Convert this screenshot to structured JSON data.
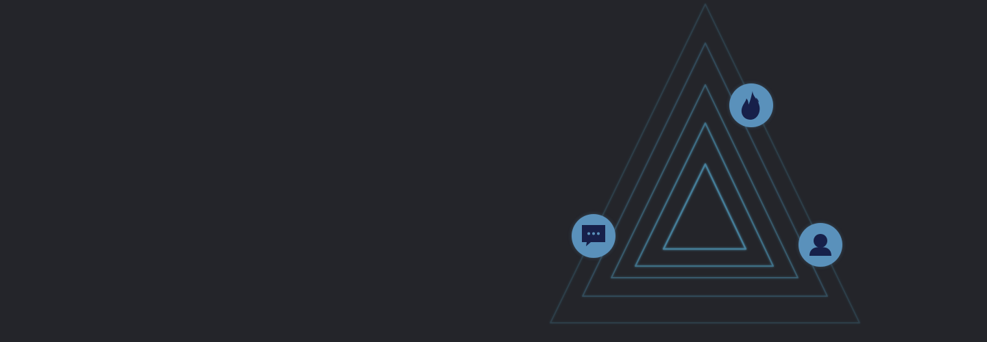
{
  "colors": {
    "background": "#24252a",
    "triangle_stroke": "#4a8aa8",
    "badge_fill": "#5a91bb",
    "icon_fill": "#17204a"
  },
  "icons": {
    "top": "flame-icon",
    "left": "chat-bubble-icon",
    "right": "user-icon"
  }
}
